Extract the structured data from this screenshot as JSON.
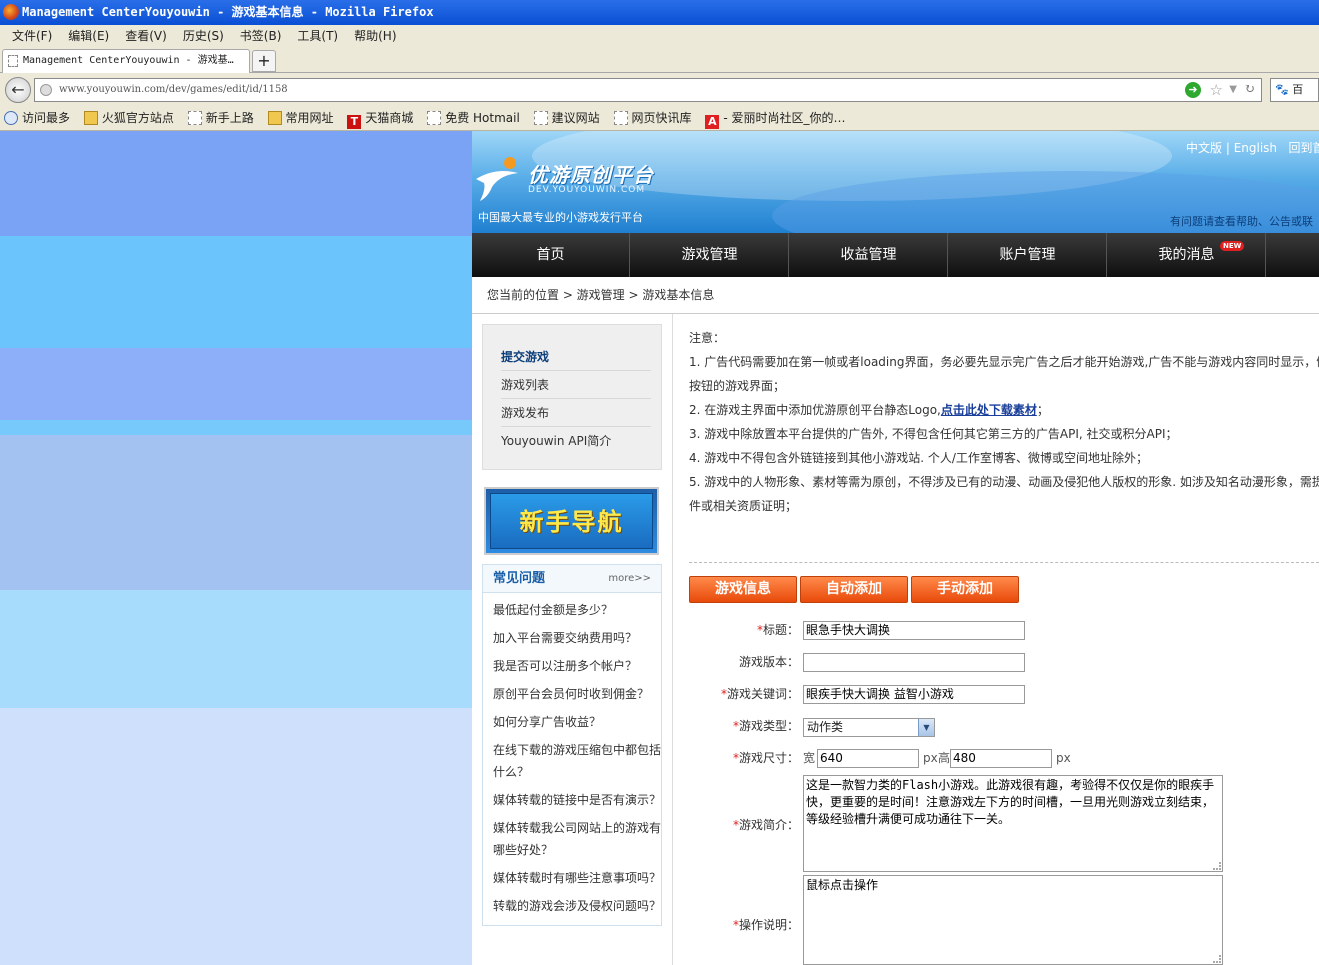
{
  "window": {
    "title": "Management CenterYouyouwin - 游戏基本信息 - Mozilla Firefox"
  },
  "menu": [
    "文件(F)",
    "编辑(E)",
    "查看(V)",
    "历史(S)",
    "书签(B)",
    "工具(T)",
    "帮助(H)"
  ],
  "tab": {
    "title": "Management CenterYouyouwin - 游戏基…",
    "new_tab": "+"
  },
  "address": {
    "url": "www.youyouwin.com/dev/games/edit/id/1158",
    "search": "百"
  },
  "bookmarks": [
    "访问最多",
    "火狐官方站点",
    "新手上路",
    "常用网址",
    "天猫商城",
    "免费 Hotmail",
    "建议网站",
    "网页快讯库",
    "- 爱丽时尚社区_你的…"
  ],
  "header": {
    "logo_text": "优游原创平台",
    "logo_sub": "DEV.YOUYOUWIN.COM",
    "slogan": "中国最大最专业的小游戏发行平台",
    "lang_cn": "中文版",
    "lang_en": "English",
    "home": "回到首",
    "help": "有问题请查看帮助、公告或联"
  },
  "nav": [
    "首页",
    "游戏管理",
    "收益管理",
    "账户管理",
    "我的消息"
  ],
  "nav_badge": "NEW",
  "breadcrumb": "您当前的位置 > 游戏管理 > 游戏基本信息",
  "sidebar": {
    "items": [
      "提交游戏",
      "游戏列表",
      "游戏发布",
      "Youyouwin API简介"
    ],
    "guide": "新手导航",
    "faq_title": "常见问题",
    "faq_more": "more>>",
    "faq": [
      "最低起付金额是多少？",
      "加入平台需要交纳费用吗？",
      "我是否可以注册多个帐户？",
      "原创平台会员何时收到佣金？",
      "如何分享广告收益？",
      "在线下载的游戏压缩包中都包括什么？",
      "媒体转载的链接中是否有演示？",
      "媒体转载我公司网站上的游戏有哪些好处？",
      "媒体转载时有哪些注意事项吗？",
      "转载的游戏会涉及侵权问题吗？"
    ]
  },
  "notes": {
    "title": "注意：",
    "n1a": "1. 广告代码需要加在第一帧或者loading界面，务必要先显示完广告之后才能开始游戏,广告不能与游戏内容同时显示，例",
    "n1b": "按钮的游戏界面；",
    "n2": "2. 在游戏主界面中添加优游原创平台静态Logo,",
    "n2_link": "点击此处下载素材",
    "n2_end": "；",
    "n3": "3. 游戏中除放置本平台提供的广告外, 不得包含任何其它第三方的广告API, 社交或积分API；",
    "n4": "4. 游戏中不得包含外链链接到其他小游戏站. 个人/工作室博客、微博或空间地址除外；",
    "n5a": "5. 游戏中的人物形象、素材等需为原创，不得涉及已有的动漫、动画及侵犯他人版权的形象. 如涉及知名动漫形象，需提",
    "n5b": "件或相关资质证明；"
  },
  "form_tabs": [
    "游戏信息",
    "自动添加",
    "手动添加"
  ],
  "form": {
    "required_mark": "*",
    "title_label": "标题：",
    "title_value": "眼急手快大调换",
    "version_label": "游戏版本：",
    "version_value": "",
    "keywords_label": "游戏关键词：",
    "keywords_value": "眼疾手快大调换 益智小游戏",
    "type_label": "游戏类型：",
    "type_value": "动作类",
    "size_label": "游戏尺寸：",
    "width_label": "宽",
    "width_value": "640",
    "unit": "px",
    "height_label": "高",
    "height_value": "480",
    "intro_label": "游戏简介：",
    "intro_value": "这是一款智力类的Flash小游戏。此游戏很有趣，考验得不仅仅是你的眼疾手快，更重要的是时间！注意游戏左下方的时间槽，一旦用光则游戏立刻结束，等级经验槽升满便可成功通往下一关。",
    "ops_label": "操作说明：",
    "ops_value": "鼠标点击操作"
  },
  "colors": {
    "accent": "#e84a0a",
    "nav_bg": "#1a1a1a",
    "link": "#1a3f9a"
  }
}
